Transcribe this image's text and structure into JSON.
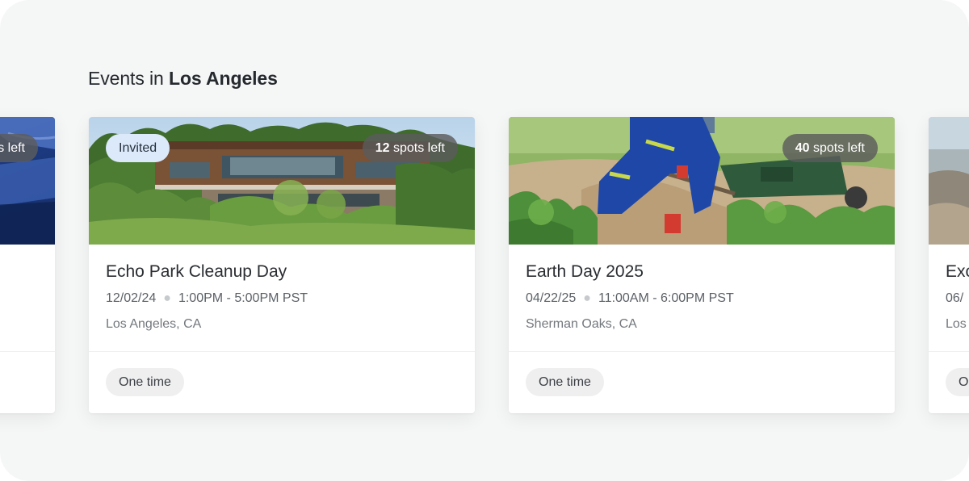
{
  "section": {
    "heading_prefix": "Events in",
    "city": "Los Angeles"
  },
  "cards": [
    {
      "title": "",
      "spots_suffix": "s left",
      "image": "car-photo"
    },
    {
      "title": "Echo Park Cleanup Day",
      "date": "12/02/24",
      "time": "1:00PM - 5:00PM PST",
      "location": "Los Angeles, CA",
      "badge": "Invited",
      "spots_count": "12",
      "spots_label": "spots left",
      "tag": "One time",
      "image": "building-in-trees-photo"
    },
    {
      "title": "Earth Day 2025",
      "date": "04/22/25",
      "time": "11:00AM - 6:00PM PST",
      "location": "Sherman Oaks, CA",
      "spots_count": "40",
      "spots_label": "spots left",
      "tag": "One time",
      "image": "volunteer-gardening-photo"
    },
    {
      "title": "Exc",
      "date": "06/",
      "location": "Los",
      "tag": "O",
      "image": "beach-photo"
    }
  ],
  "colors": {
    "page_bg": "#f5f6f6",
    "card_bg": "#ffffff",
    "invited_badge": "#dbe9fb",
    "spots_badge": "#5c5c5c",
    "tag_bg": "#efefef"
  }
}
